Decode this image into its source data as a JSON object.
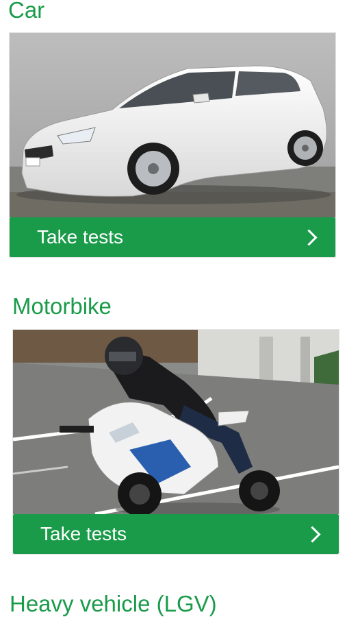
{
  "sections": [
    {
      "title": "Car",
      "image_alt": "white hatchback car",
      "cta_label": "Take tests",
      "cta_icon": "chevron-right-icon"
    },
    {
      "title": "Motorbike",
      "image_alt": "rider leaning into a bend on a sport motorbike",
      "cta_label": "Take tests",
      "cta_icon": "chevron-right-icon"
    },
    {
      "title": "Heavy vehicle (LGV)"
    }
  ],
  "colors": {
    "brand_green": "#1a9b4a",
    "text_on_green": "#ffffff"
  }
}
